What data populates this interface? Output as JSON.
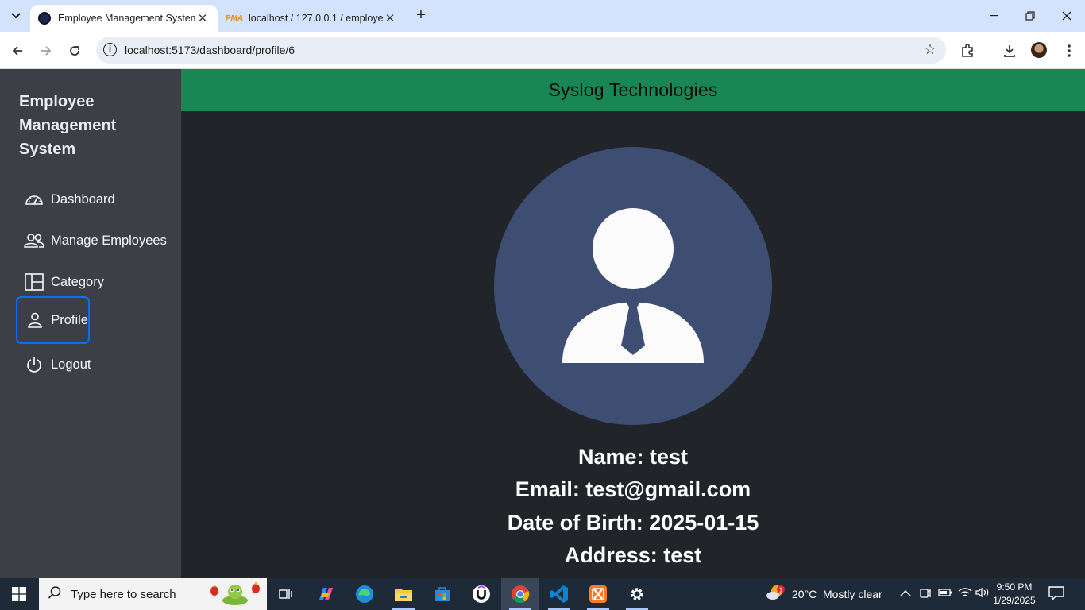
{
  "browser": {
    "tabs": [
      {
        "title": "Employee Management System",
        "active": true
      },
      {
        "title": "localhost / 127.0.0.1 / employee",
        "active": false
      }
    ],
    "pma_favicon_text": "PMA",
    "url": "localhost:5173/dashboard/profile/6"
  },
  "app": {
    "brand_line1": "Employee",
    "brand_line2": "Management",
    "brand_line3": "System",
    "nav": [
      {
        "label": "Dashboard",
        "icon": "speedometer-icon"
      },
      {
        "label": "Manage Employees",
        "icon": "people-icon"
      },
      {
        "label": "Category",
        "icon": "columns-icon"
      },
      {
        "label": "Profile",
        "icon": "person-icon",
        "active": true
      },
      {
        "label": "Logout",
        "icon": "power-icon"
      }
    ],
    "header_title": "Syslog Technologies",
    "profile": {
      "name": "Name: test",
      "email": "Email: test@gmail.com",
      "dob": "Date of Birth: 2025-01-15",
      "address": "Address: test"
    }
  },
  "taskbar": {
    "search_placeholder": "Type here to search",
    "weather_temp": "20°C",
    "weather_text": "Mostly clear",
    "weather_badge": "1",
    "time": "9:50 PM",
    "date": "1/29/2025"
  },
  "colors": {
    "sidebar": "#3c3f46",
    "header": "#198754",
    "main": "#212529",
    "active_border": "#0d6efd",
    "avatar_bg": "#3e4e72"
  }
}
